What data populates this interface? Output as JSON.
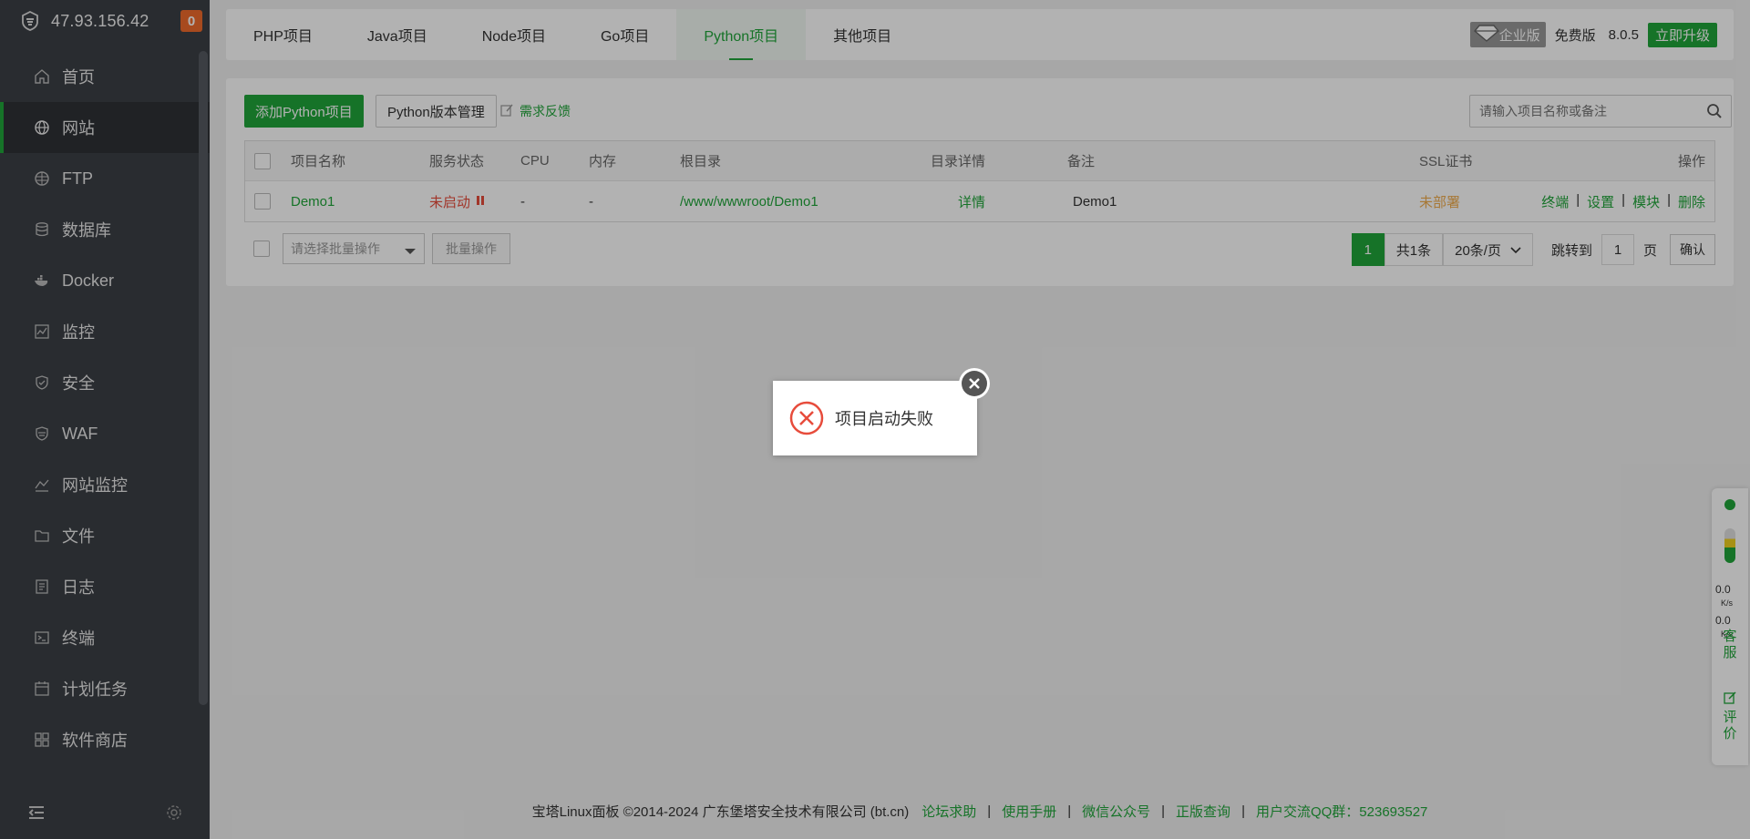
{
  "sidebar": {
    "ip": "47.93.156.42",
    "badge": "0",
    "items": [
      {
        "label": "首页",
        "icon": "home-icon"
      },
      {
        "label": "网站",
        "icon": "globe-icon"
      },
      {
        "label": "FTP",
        "icon": "ftp-globe-icon"
      },
      {
        "label": "数据库",
        "icon": "database-icon"
      },
      {
        "label": "Docker",
        "icon": "docker-icon"
      },
      {
        "label": "监控",
        "icon": "monitor-icon"
      },
      {
        "label": "安全",
        "icon": "shield-icon"
      },
      {
        "label": "WAF",
        "icon": "waf-shield-icon"
      },
      {
        "label": "网站监控",
        "icon": "chart-line-icon"
      },
      {
        "label": "文件",
        "icon": "folder-icon"
      },
      {
        "label": "日志",
        "icon": "log-icon"
      },
      {
        "label": "终端",
        "icon": "terminal-icon"
      },
      {
        "label": "计划任务",
        "icon": "calendar-icon"
      },
      {
        "label": "软件商店",
        "icon": "grid-icon"
      }
    ]
  },
  "tabs": [
    "PHP项目",
    "Java项目",
    "Node项目",
    "Go项目",
    "Python项目",
    "其他项目"
  ],
  "topbar": {
    "edition": "企业版",
    "free": "免费版",
    "version": "8.0.5",
    "upgrade": "立即升级"
  },
  "toolbar": {
    "add_label": "添加Python项目",
    "version_mgmt_label": "Python版本管理",
    "feedback_label": "需求反馈",
    "search_placeholder": "请输入项目名称或备注"
  },
  "table": {
    "headers": {
      "name": "项目名称",
      "status": "服务状态",
      "cpu": "CPU",
      "mem": "内存",
      "root": "根目录",
      "detail": "目录详情",
      "remark": "备注",
      "ssl": "SSL证书",
      "ops": "操作"
    },
    "rows": [
      {
        "name": "Demo1",
        "status": "未启动",
        "cpu": "-",
        "mem": "-",
        "root": "/www/wwwroot/Demo1",
        "detail": "详情",
        "remark": "Demo1",
        "ssl": "未部署",
        "ops": [
          "终端",
          "设置",
          "模块",
          "删除"
        ]
      }
    ]
  },
  "batch": {
    "select_placeholder": "请选择批量操作",
    "button": "批量操作"
  },
  "pager": {
    "current": "1",
    "total": "共1条",
    "per_page": "20条/页",
    "jump_label": "跳转到",
    "jump_value": "1",
    "page_suffix": "页",
    "confirm": "确认"
  },
  "footer": {
    "copyright": "宝塔Linux面板 ©2014-2024 广东堡塔安全技术有限公司 (bt.cn)",
    "links": [
      "论坛求助",
      "使用手册",
      "微信公众号",
      "正版查询",
      "用户交流QQ群：523693527"
    ]
  },
  "float_widget": {
    "up_speed": "0.0",
    "up_unit": "K/s",
    "down_speed": "0.0",
    "down_unit": "K/s",
    "service_label_1": "客",
    "service_label_2": "服",
    "rate_label_1": "评",
    "rate_label_2": "价"
  },
  "dialog": {
    "message": "项目启动失败"
  },
  "colors": {
    "accent": "#20a53a",
    "sidebar_bg": "#3b3f45",
    "badge": "#f06a2b",
    "error": "#e74c3c",
    "warning": "#f0ad4e"
  }
}
